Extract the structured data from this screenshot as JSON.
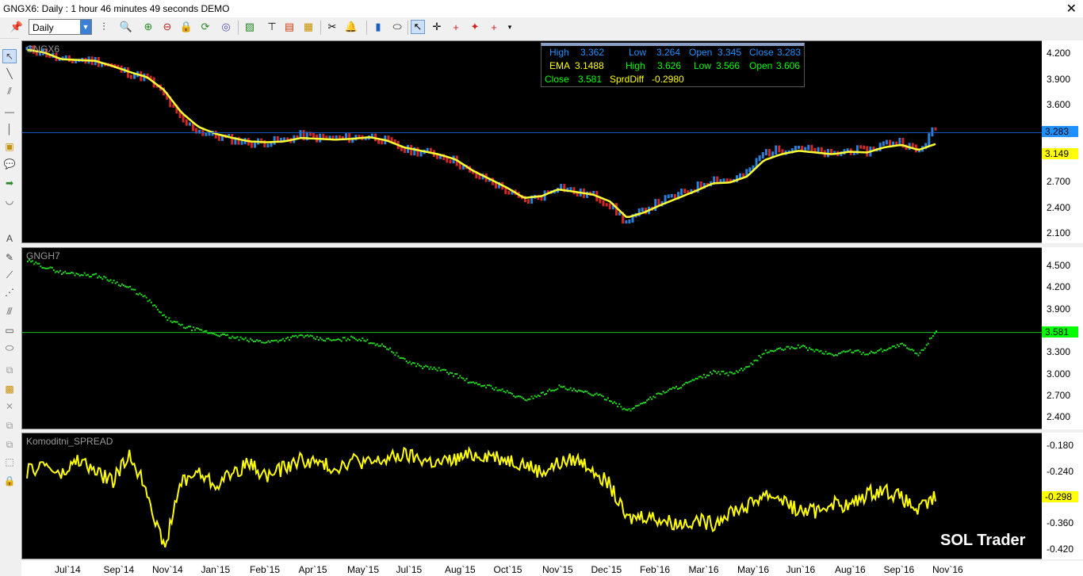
{
  "window": {
    "title": "GNGX6: Daily : 1 hour 46 minutes 49 seconds DEMO",
    "close_glyph": "✕"
  },
  "toolbar": {
    "period": "Daily",
    "icons": [
      "pin-icon",
      "bar-type-icon",
      "zoom-icon",
      "zoom-in-icon",
      "zoom-out-icon",
      "lock-icon",
      "refresh-icon",
      "indicator-icon",
      "chart-style-icon",
      "hierarchy-icon",
      "template-icon",
      "scissors-icon",
      "alert-bell-icon",
      "save-icon",
      "mouse-icon",
      "cursor-icon",
      "crosshair-icon",
      "crosshair-red-icon",
      "crosshair-dot-icon",
      "crosshair-arrow-icon",
      "more-icon"
    ]
  },
  "leftbar": {
    "tools": [
      "select-tool-icon",
      "line-tool-icon",
      "channel-tool-icon",
      "hline-tool-icon",
      "vline-tool-icon",
      "note-tool-icon",
      "callout-tool-icon",
      "arrow-tool-icon",
      "arc-tool-icon",
      "text-tool-icon",
      "pencil-tool-icon",
      "ray-tool-icon",
      "fan-tool-icon",
      "parallel-tool-icon",
      "rectangle-tool-icon",
      "ellipse-tool-icon",
      "layers-tool-icon",
      "picture-tool-icon",
      "delete-tool-icon",
      "copy-tool-icon",
      "duplicate-tool-icon",
      "dotted-rect-tool-icon",
      "lock-tool-icon"
    ]
  },
  "infobox": {
    "high_label": "High",
    "high_val": "3.362",
    "low_label": "Low",
    "low_val": "3.264",
    "open_label": "Open",
    "open_val": "3.345",
    "close_label": "Close",
    "close_val": "3.283",
    "ema_label": "EMA",
    "ema_val": "3.1488",
    "high2_label": "High",
    "high2_val": "3.626",
    "low2_label": "Low",
    "low2_val": "3.566",
    "open2_label": "Open",
    "open2_val": "3.606",
    "close2_label": "Close",
    "close2_val": "3.581",
    "spread_label": "SprdDiff",
    "spread_val": "-0.2980"
  },
  "panes": [
    {
      "name": "GNGX6",
      "ticks": [
        "4.200",
        "3.900",
        "3.600",
        "3.300",
        "3.000",
        "2.700",
        "2.400",
        "2.100"
      ],
      "last_price": "3.283",
      "last_color": "#1e90ff",
      "ema_last": "3.149",
      "ema_color": "#ffff00"
    },
    {
      "name": "GNGH7",
      "ticks": [
        "4.500",
        "4.200",
        "3.900",
        "3.600",
        "3.300",
        "3.000",
        "2.700",
        "2.400"
      ],
      "last_price": "3.581",
      "last_color": "#00ff00"
    },
    {
      "name": "Komoditni_SPREAD",
      "ticks": [
        "-0.180",
        "-0.240",
        "-0.300",
        "-0.360",
        "-0.420"
      ],
      "last_price": "-0.298",
      "last_color": "#ffff00"
    }
  ],
  "xaxis": [
    "Jul`14",
    "Sep`14",
    "Nov`14",
    "Jan`15",
    "Feb`15",
    "Apr`15",
    "May`15",
    "Jul`15",
    "Aug`15",
    "Oct`15",
    "Nov`15",
    "Dec`15",
    "Feb`16",
    "Mar`16",
    "May`16",
    "Jun`16",
    "Aug`16",
    "Sep`16",
    "Nov`16"
  ],
  "watermark": "SOL Trader",
  "chart_data": {
    "type": "line",
    "x_start": "Jul`14",
    "x_end": "Nov`16",
    "series": [
      {
        "name": "GNGX6",
        "kind": "ohlc bars",
        "values": [
          4.25,
          4.22,
          4.12,
          4.13,
          4.12,
          4.05,
          3.97,
          3.92,
          3.72,
          3.42,
          3.3,
          3.24,
          3.2,
          3.16,
          3.17,
          3.19,
          3.25,
          3.22,
          3.21,
          3.22,
          3.24,
          3.18,
          3.08,
          3.06,
          3.02,
          2.95,
          2.79,
          2.72,
          2.6,
          2.48,
          2.54,
          2.66,
          2.58,
          2.55,
          2.44,
          2.22,
          2.38,
          2.48,
          2.55,
          2.64,
          2.74,
          2.72,
          2.8,
          3.05,
          3.08,
          3.12,
          3.06,
          3.02,
          3.08,
          3.06,
          3.15,
          3.18,
          3.05,
          3.34
        ]
      },
      {
        "name": "EMA",
        "kind": "line",
        "values": [
          4.25,
          4.22,
          4.14,
          4.13,
          4.12,
          4.06,
          3.99,
          3.93,
          3.78,
          3.52,
          3.35,
          3.27,
          3.22,
          3.18,
          3.17,
          3.18,
          3.22,
          3.21,
          3.2,
          3.21,
          3.23,
          3.19,
          3.11,
          3.07,
          3.03,
          2.97,
          2.84,
          2.74,
          2.64,
          2.52,
          2.54,
          2.62,
          2.59,
          2.56,
          2.48,
          2.29,
          2.35,
          2.44,
          2.52,
          2.6,
          2.69,
          2.7,
          2.77,
          2.96,
          3.03,
          3.07,
          3.05,
          3.03,
          3.06,
          3.05,
          3.11,
          3.14,
          3.08,
          3.149
        ]
      },
      {
        "name": "GNGH7",
        "kind": "dots",
        "values": [
          4.58,
          4.5,
          4.42,
          4.4,
          4.38,
          4.3,
          4.2,
          4.05,
          3.8,
          3.68,
          3.62,
          3.57,
          3.52,
          3.48,
          3.46,
          3.5,
          3.55,
          3.5,
          3.48,
          3.52,
          3.46,
          3.38,
          3.2,
          3.12,
          3.08,
          3.0,
          2.88,
          2.84,
          2.76,
          2.66,
          2.74,
          2.84,
          2.78,
          2.74,
          2.66,
          2.5,
          2.64,
          2.76,
          2.84,
          2.94,
          3.04,
          3.02,
          3.1,
          3.32,
          3.36,
          3.4,
          3.34,
          3.28,
          3.34,
          3.3,
          3.36,
          3.42,
          3.28,
          3.62
        ]
      },
      {
        "name": "Komoditni_SPREAD",
        "kind": "line",
        "values": [
          -0.24,
          -0.22,
          -0.25,
          -0.21,
          -0.24,
          -0.26,
          -0.2,
          -0.28,
          -0.42,
          -0.26,
          -0.24,
          -0.27,
          -0.24,
          -0.22,
          -0.25,
          -0.23,
          -0.21,
          -0.22,
          -0.23,
          -0.21,
          -0.22,
          -0.21,
          -0.2,
          -0.21,
          -0.22,
          -0.21,
          -0.2,
          -0.2,
          -0.21,
          -0.22,
          -0.24,
          -0.22,
          -0.21,
          -0.23,
          -0.27,
          -0.35,
          -0.34,
          -0.35,
          -0.36,
          -0.35,
          -0.36,
          -0.33,
          -0.32,
          -0.29,
          -0.3,
          -0.33,
          -0.33,
          -0.31,
          -0.32,
          -0.29,
          -0.28,
          -0.3,
          -0.33,
          -0.298
        ]
      }
    ],
    "ylim": [
      [
        2.0,
        4.35
      ],
      [
        2.25,
        4.75
      ],
      [
        -0.44,
        -0.15
      ]
    ],
    "grid": false
  }
}
